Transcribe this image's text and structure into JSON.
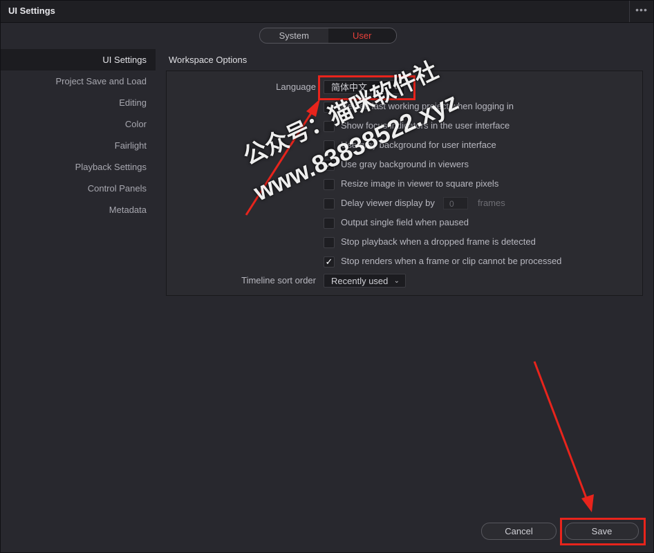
{
  "window": {
    "title": "UI Settings",
    "more_icon": "more-horizontal-icon"
  },
  "tabs": [
    {
      "label": "System",
      "active": false
    },
    {
      "label": "User",
      "active": true
    }
  ],
  "sidebar": {
    "items": [
      {
        "label": "UI Settings",
        "active": true
      },
      {
        "label": "Project Save and Load"
      },
      {
        "label": "Editing"
      },
      {
        "label": "Color"
      },
      {
        "label": "Fairlight"
      },
      {
        "label": "Playback Settings"
      },
      {
        "label": "Control Panels"
      },
      {
        "label": "Metadata"
      }
    ]
  },
  "main": {
    "section_title": "Workspace Options",
    "language": {
      "label": "Language",
      "value": "简体中文"
    },
    "options": [
      {
        "label": "Reload last working project when logging in",
        "checked": false
      },
      {
        "label": "Show focus indicators in the user interface",
        "checked": false
      },
      {
        "label": "Use gray background for user interface",
        "checked": false
      },
      {
        "label": "Use gray background in viewers",
        "checked": true
      },
      {
        "label": "Resize image in viewer to square pixels",
        "checked": false
      },
      {
        "label": "Delay viewer display by",
        "checked": false,
        "input_value": "0",
        "suffix": "frames"
      },
      {
        "label": "Output single field when paused",
        "checked": false
      },
      {
        "label": "Stop playback when a dropped frame is detected",
        "checked": false
      },
      {
        "label": "Stop renders when a frame or clip cannot be processed",
        "checked": true
      }
    ],
    "timeline_sort": {
      "label": "Timeline sort order",
      "value": "Recently used"
    }
  },
  "footer": {
    "cancel_label": "Cancel",
    "save_label": "Save"
  },
  "watermark": {
    "line1": "公众号：猫咪软件社",
    "line2": "www.83838522.xyz"
  },
  "colors": {
    "accent": "#e8403a",
    "annotation": "#e8241c",
    "background": "#28282e"
  }
}
